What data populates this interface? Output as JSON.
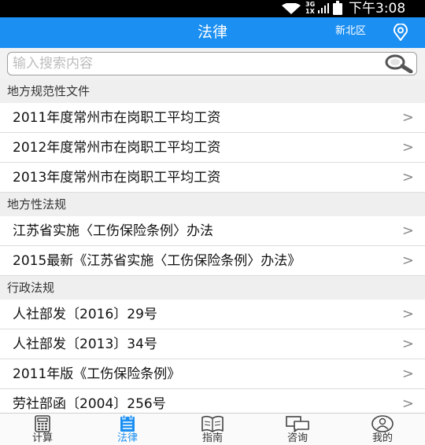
{
  "status_bar": {
    "network": "3G",
    "network_sub": "1X",
    "time": "下午3:08"
  },
  "header": {
    "title": "法律",
    "region": "新北区"
  },
  "search": {
    "placeholder": "输入搜索内容",
    "value": ""
  },
  "sections": [
    {
      "title": "地方规范性文件",
      "items": [
        "2011年度常州市在岗职工平均工资",
        "2012年度常州市在岗职工平均工资",
        "2013年度常州市在岗职工平均工资"
      ]
    },
    {
      "title": "地方性法规",
      "items": [
        "江苏省实施〈工伤保险条例〉办法",
        "2015最新《江苏省实施〈工伤保险条例〉办法》"
      ]
    },
    {
      "title": "行政法规",
      "items": [
        "人社部发〔2016〕29号",
        "人社部发〔2013〕34号",
        "2011年版《工伤保险条例》",
        "劳社部函〔2004〕256号"
      ]
    }
  ],
  "chevron": ">",
  "bottom_nav": [
    {
      "label": "计算",
      "icon": "calculator-icon",
      "active": false
    },
    {
      "label": "法律",
      "icon": "law-book-icon",
      "active": true
    },
    {
      "label": "指南",
      "icon": "open-book-icon",
      "active": false
    },
    {
      "label": "咨询",
      "icon": "chat-bubbles-icon",
      "active": false
    },
    {
      "label": "我的",
      "icon": "user-icon",
      "active": false
    }
  ],
  "colors": {
    "primary": "#1b8ff2",
    "section_bg": "#efefef",
    "divider": "#dcdcdc"
  }
}
